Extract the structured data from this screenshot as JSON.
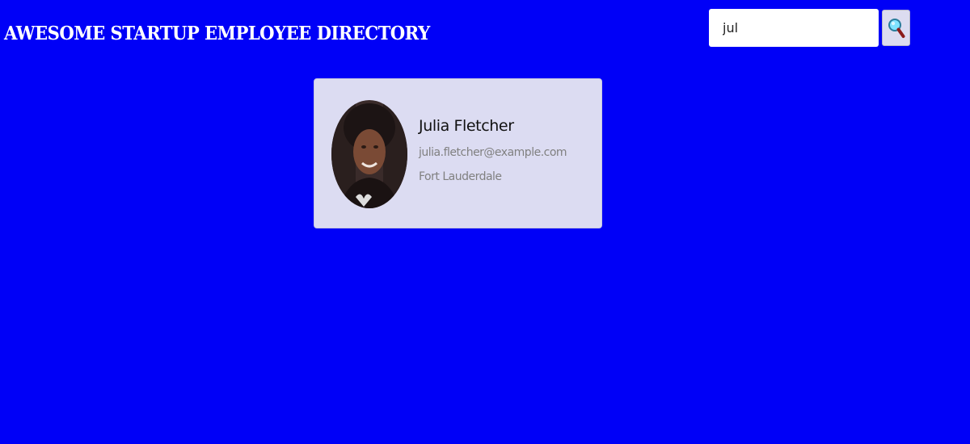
{
  "header": {
    "title": "AWESOME STARTUP EMPLOYEE DIRECTORY"
  },
  "search": {
    "value": "jul",
    "button_icon": "magnifier-icon"
  },
  "employees": [
    {
      "name": "Julia Fletcher",
      "email": "julia.fletcher@example.com",
      "city": "Fort Lauderdale",
      "avatar_icon": "profile-photo"
    }
  ],
  "colors": {
    "background": "#0000f7",
    "card": "#dcdcf2",
    "title": "#ffffff"
  }
}
